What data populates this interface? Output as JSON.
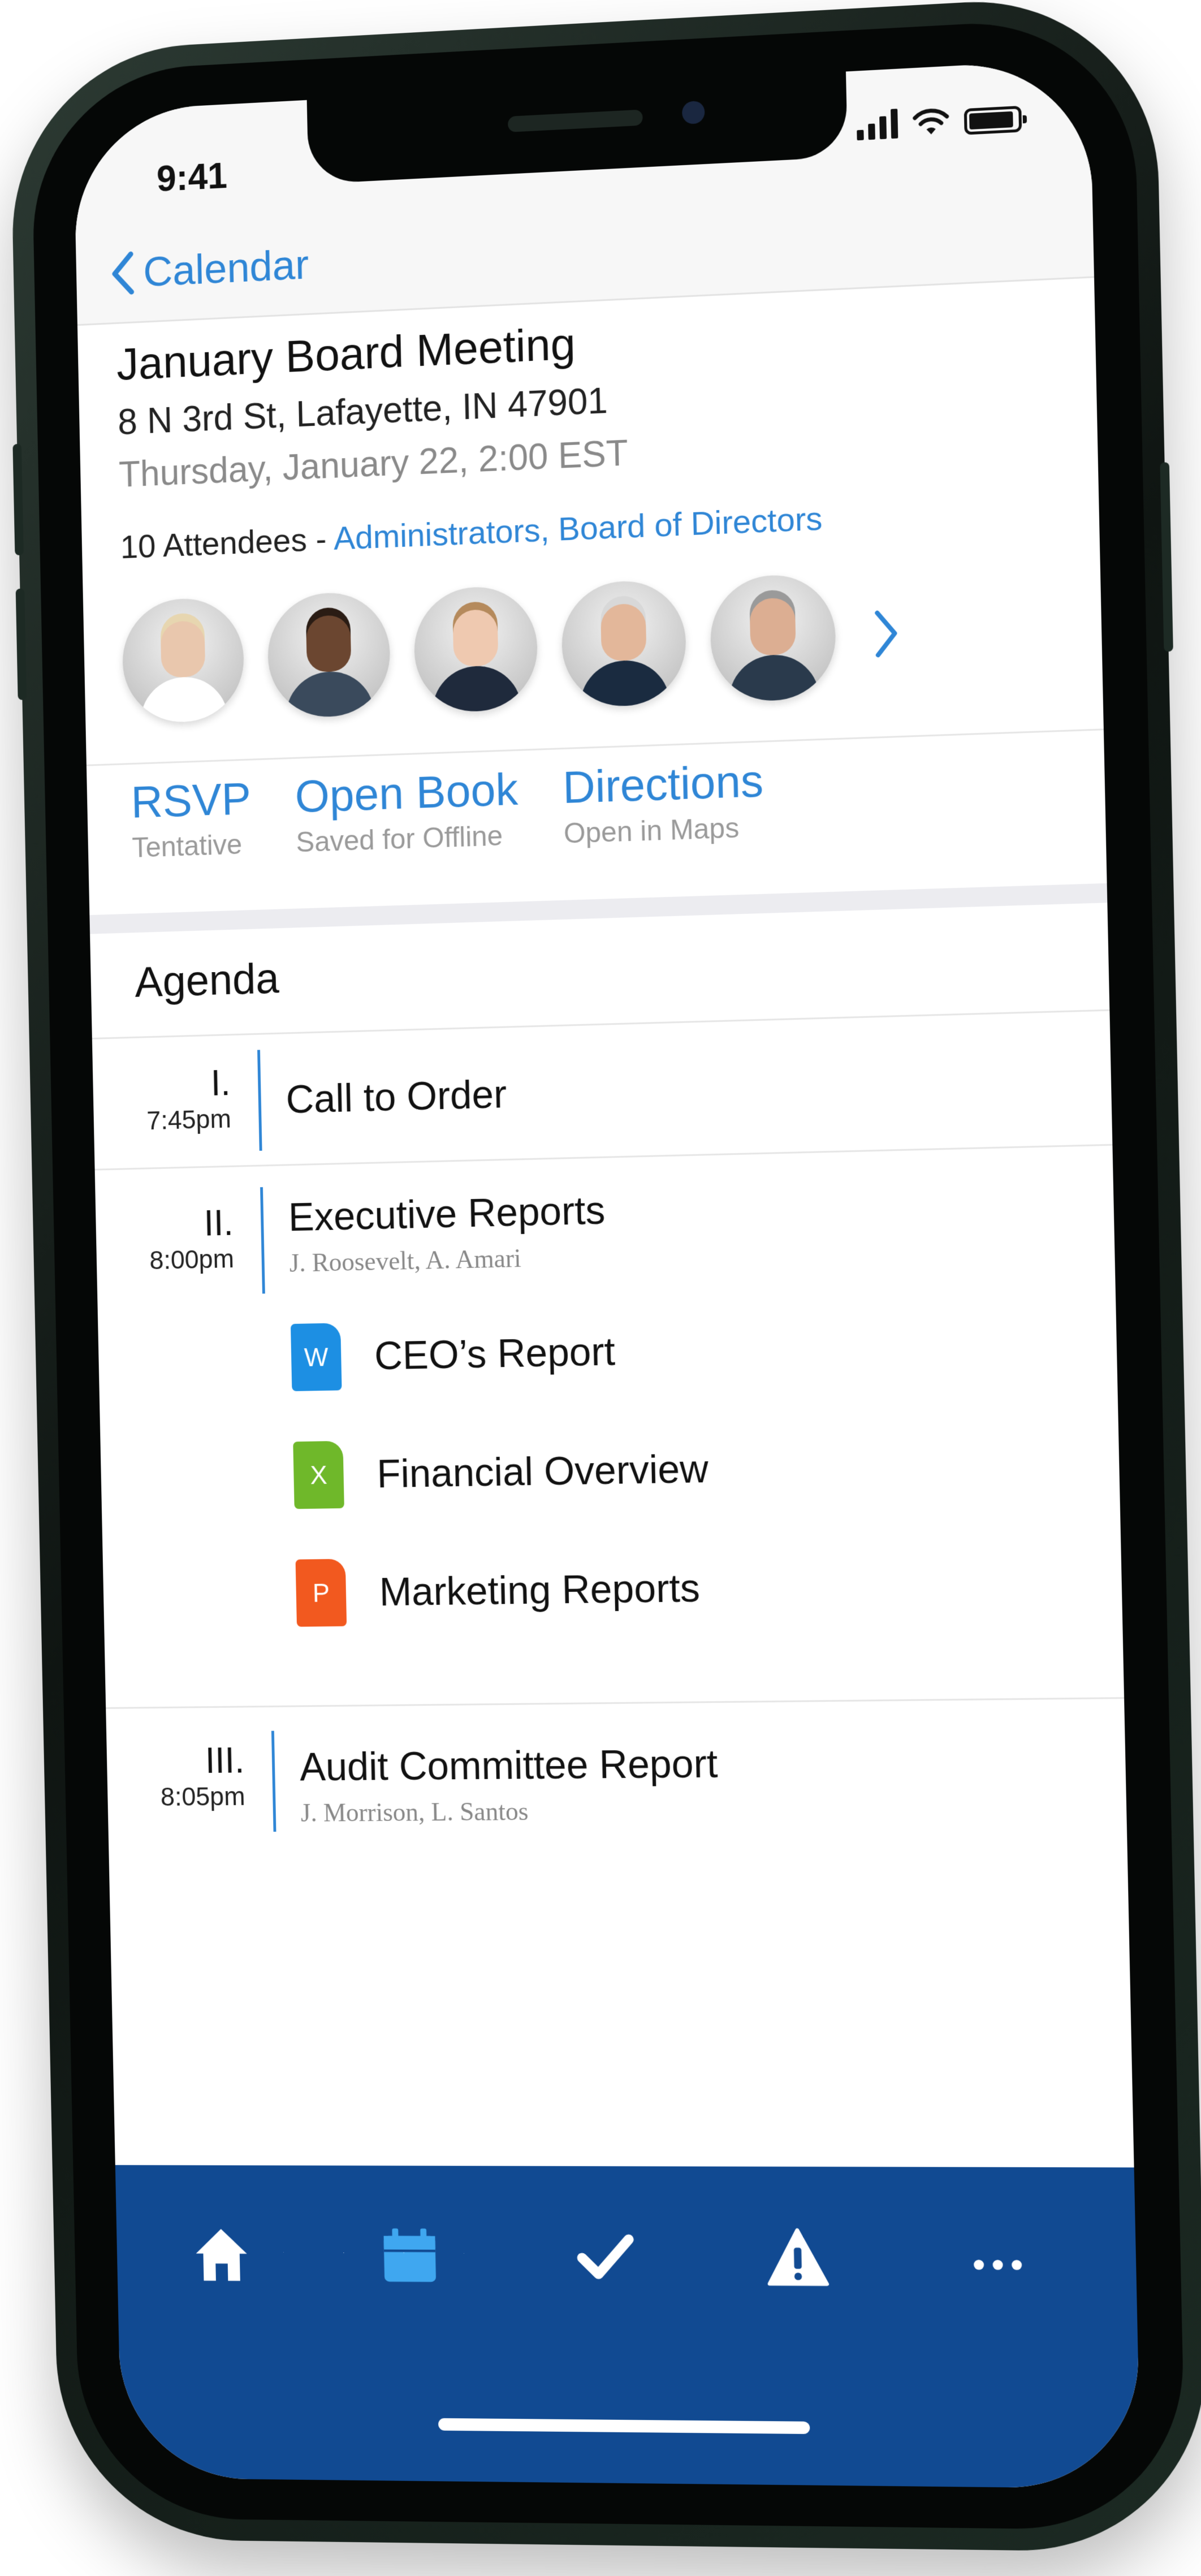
{
  "status_bar": {
    "time": "9:41"
  },
  "nav": {
    "back_label": "Calendar"
  },
  "event": {
    "title": "January Board Meeting",
    "address": "8 N 3rd St, Lafayette, IN 47901",
    "datetime": "Thursday, January 22, 2:00 EST",
    "attendee_count": "10 Attendees - ",
    "attendee_groups": "Administrators, Board of Directors"
  },
  "avatars": [
    {
      "skin": "#e9c7ad",
      "hair": "#e7d6b0",
      "clothes": "#ffffff"
    },
    {
      "skin": "#6b4630",
      "hair": "#2a1c14",
      "clothes": "#3a4a5c"
    },
    {
      "skin": "#efc9b0",
      "hair": "#b58a5c",
      "clothes": "#1f2a3c"
    },
    {
      "skin": "#e3b79a",
      "hair": "#d8d8d8",
      "clothes": "#1a2b40"
    },
    {
      "skin": "#dcae92",
      "hair": "#9a9a9a",
      "clothes": "#2a3a4c"
    }
  ],
  "actions": [
    {
      "label": "RSVP",
      "sub": "Tentative"
    },
    {
      "label": "Open Book",
      "sub": "Saved for Offline"
    },
    {
      "label": "Directions",
      "sub": "Open in Maps"
    }
  ],
  "agenda": {
    "heading": "Agenda",
    "items": [
      {
        "num": "I.",
        "time": "7:45pm",
        "title": "Call to Order",
        "presenters": ""
      },
      {
        "num": "II.",
        "time": "8:00pm",
        "title": "Executive Reports",
        "presenters": "J. Roosevelt, A. Amari"
      },
      {
        "num": "III.",
        "time": "8:05pm",
        "title": "Audit Committee Report",
        "presenters": "J. Morrison, L. Santos"
      }
    ],
    "documents": [
      {
        "letter": "W",
        "name": "CEO’s Report",
        "color": "#1d8fe3"
      },
      {
        "letter": "X",
        "name": "Financial Overview",
        "color": "#6fb82a"
      },
      {
        "letter": "P",
        "name": "Marketing Reports",
        "color": "#f2591f"
      }
    ]
  },
  "tabbar": {
    "color": "#114a92",
    "active_color": "#3fa7f0",
    "tabs": [
      "home-icon",
      "calendar-icon",
      "checkmark-icon",
      "warning-icon",
      "more-icon"
    ]
  }
}
